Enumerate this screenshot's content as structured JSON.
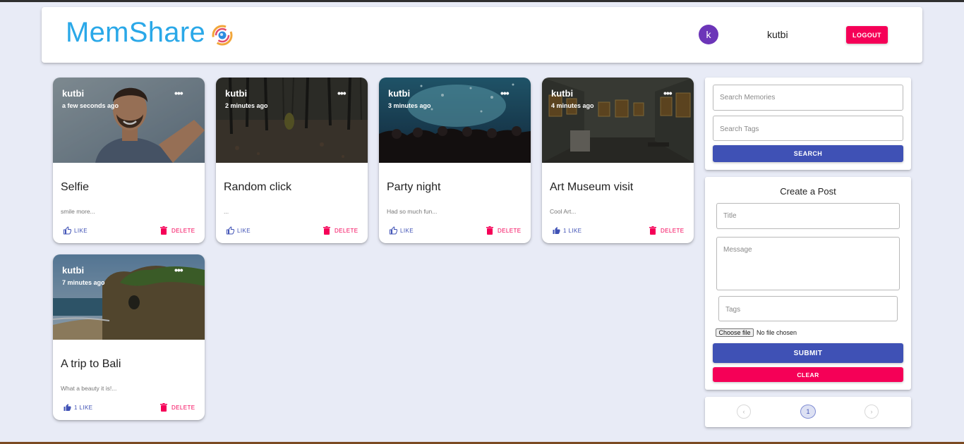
{
  "header": {
    "brand": "MemShare",
    "avatar_initial": "k",
    "username": "kutbi",
    "logout_label": "LOGOUT"
  },
  "colors": {
    "primary": "#3f51b5",
    "secondary": "#f50057",
    "brand": "#2aa8e8",
    "background": "#e8ebf6",
    "avatar": "#6c35b8"
  },
  "posts": [
    {
      "author": "kutbi",
      "time": "a few seconds ago",
      "title": "Selfie",
      "message": "smile more...",
      "like_label": "LIKE",
      "delete_label": "DELETE",
      "more_icon": "more-horiz-icon"
    },
    {
      "author": "kutbi",
      "time": "2 minutes ago",
      "title": "Random click",
      "message": "...",
      "like_label": "LIKE",
      "delete_label": "DELETE",
      "more_icon": "more-horiz-icon"
    },
    {
      "author": "kutbi",
      "time": "3 minutes ago",
      "title": "Party night",
      "message": "Had so much fun...",
      "like_label": "LIKE",
      "delete_label": "DELETE",
      "more_icon": "more-horiz-icon"
    },
    {
      "author": "kutbi",
      "time": "4 minutes ago",
      "title": "Art Museum visit",
      "message": "Cool Art...",
      "like_label": "1 LIKE",
      "delete_label": "DELETE",
      "more_icon": "more-horiz-icon"
    },
    {
      "author": "kutbi",
      "time": "7 minutes ago",
      "title": "A trip to Bali",
      "message": "What a beauty it is!...",
      "like_label": "1 LIKE",
      "delete_label": "DELETE",
      "more_icon": "more-horiz-icon"
    }
  ],
  "search": {
    "memories_placeholder": "Search Memories",
    "tags_placeholder": "Search Tags",
    "button_label": "SEARCH"
  },
  "form": {
    "title": "Create a Post",
    "title_placeholder": "Title",
    "message_placeholder": "Message",
    "tags_placeholder": "Tags",
    "file_button": "Choose file",
    "file_status": "No file chosen",
    "submit_label": "SUBMIT",
    "clear_label": "CLEAR"
  },
  "pagination": {
    "prev": "‹",
    "current": "1",
    "next": "›"
  }
}
